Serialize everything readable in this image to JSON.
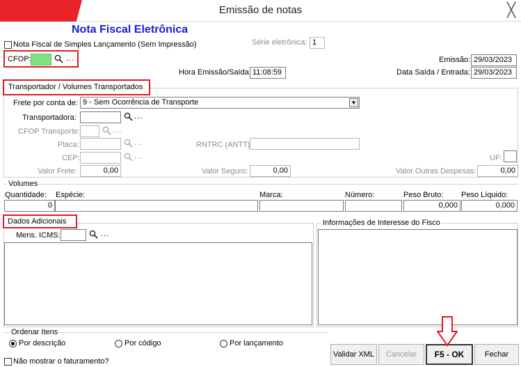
{
  "window": {
    "title": "Emissão de notas",
    "close_glyph": "╳"
  },
  "form": {
    "heading": "Nota Fiscal Eletrônica",
    "simples_label": "Nota Fiscal de Simples Lançamento (Sem Impressão)",
    "serie_label": "Série eletrônica:",
    "serie_value": "1",
    "cfop_label": "CFOP:",
    "cfop_value": "",
    "emissao_label": "Emissão:",
    "emissao_value": "29/03/2023",
    "hora_label": "Hora Emissão/Saída:",
    "hora_value": "11:08:59",
    "data_saida_label": "Data Saída / Entrada:",
    "data_saida_value": "29/03/2023"
  },
  "transport": {
    "group_title": "Transportador /  Volumes Transportados",
    "frete_label": "Frete por conta de:",
    "frete_value": "9 - Sem Ocorrência de Transporte",
    "transportadora_label": "Transportadora:",
    "cfop_transp_label": "CFOP Transporte:",
    "placa_label": "Placa:",
    "rntrc_label": "RNTRC (ANTT):",
    "cep_label": "CEP:",
    "uf_label": "UF:",
    "valor_frete_label": "Valor Frete:",
    "valor_frete_value": "0,00",
    "valor_seguro_label": "Valor Seguro:",
    "valor_seguro_value": "0,00",
    "outras_label": "Valor Outras Despesas:",
    "outras_value": "0,00"
  },
  "volumes": {
    "title": "Volumes",
    "quantidade_label": "Quantidade:",
    "quantidade_value": "0",
    "especie_label": "Espécie:",
    "marca_label": "Marca:",
    "numero_label": "Número:",
    "peso_bruto_label": "Peso Bruto:",
    "peso_bruto_value": "0,000",
    "peso_liquido_label": "Peso Líquido:",
    "peso_liquido_value": "0,000"
  },
  "adicionais": {
    "title": "Dados Adicionais",
    "mens_icms_label": "Mens. ICMS:",
    "fisco_title": "Informações de Interesse do Fisco"
  },
  "ordenar": {
    "title": "Ordenar Itens",
    "options": [
      "Por descrição",
      "Por código",
      "Por lançamento"
    ],
    "selected": "Por descrição"
  },
  "footer": {
    "nao_mostrar_label": "Não mostrar o faturamento?",
    "validar_label": "Validar XML",
    "cancelar_label": "Cancelar",
    "ok_label": "F5 - OK",
    "fechar_label": "Fechar"
  },
  "colors": {
    "accent_red": "#e01b22",
    "heading_blue": "#1a1ad6",
    "cfop_green": "#7fe07f"
  },
  "icons": {
    "lookup": "magnifier-icon",
    "more": "ellipsis-icon",
    "dropdown": "dropdown-arrow-icon"
  }
}
